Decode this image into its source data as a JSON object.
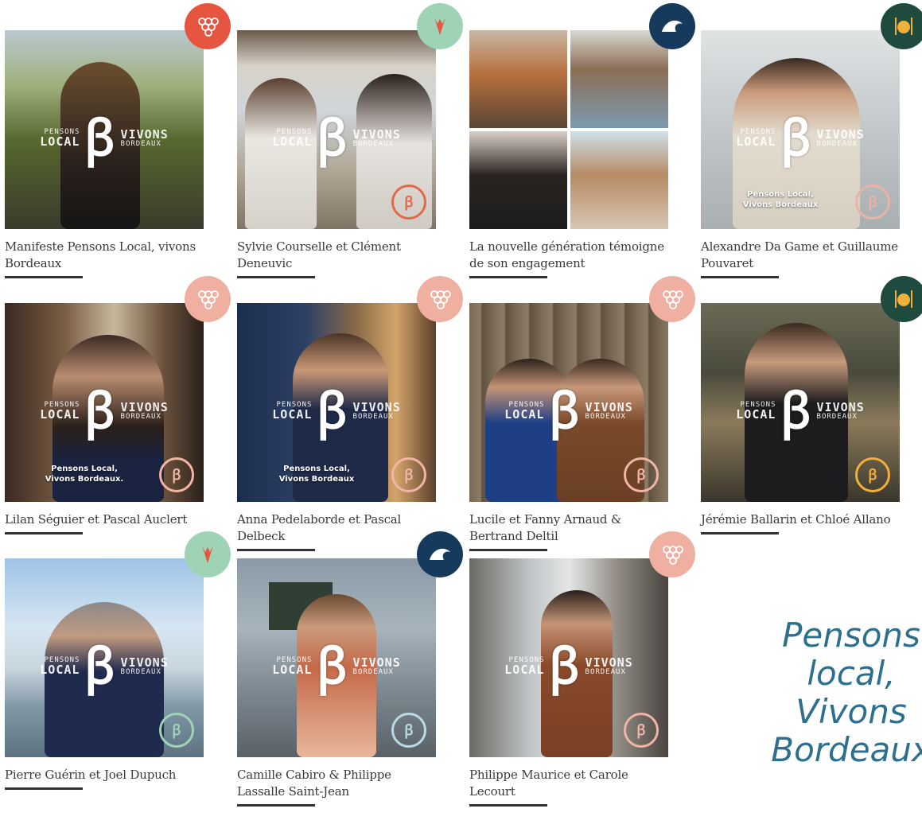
{
  "watermark": {
    "left_top": "PENSONS",
    "left_bottom": "LOCAL",
    "right_top": "VIVONS",
    "right_bottom": "BORDEAUX",
    "glyph": "ꞵ"
  },
  "banner_text_a": "Pensons Local,",
  "banner_text_b": "Vivons Bordeaux.",
  "banner_text_c": "Vivons Bordeaux",
  "slogan": "Pensons local, Vivons Bordeaux",
  "badge_colors": {
    "grape": "#e5553f",
    "grape_light": "#efb0a2",
    "oyster": "#9fd3b6",
    "wave": "#163a5b",
    "food": "#1f4b3e"
  },
  "cards": [
    {
      "title": "Manifeste Pensons Local, vivons Bordeaux",
      "badge": "grape-icon"
    },
    {
      "title": "Sylvie Courselle et Clément Deneuvic",
      "badge": "oyster-icon"
    },
    {
      "title": "La nouvelle génération témoigne de son engagement",
      "badge": "wave-icon"
    },
    {
      "title": "Alexandre Da Game et Guillaume Pouvaret",
      "badge": "plate-icon"
    },
    {
      "title": "Lilan Séguier et Pascal Auclert",
      "badge": "grape-icon"
    },
    {
      "title": "Anna Pedelaborde et Pascal Delbeck",
      "badge": "grape-icon"
    },
    {
      "title": "Lucile et Fanny Arnaud & Bertrand Deltil",
      "badge": "grape-icon"
    },
    {
      "title": "Jérémie Ballarin et Chloé Allano",
      "badge": "plate-icon"
    },
    {
      "title": "Pierre Guérin et Joel Dupuch",
      "badge": "oyster-icon"
    },
    {
      "title": "Camille Cabiro & Philippe Lassalle Saint-Jean",
      "badge": "wave-icon"
    },
    {
      "title": "Philippe Maurice et Carole Lecourt",
      "badge": "grape-icon"
    }
  ]
}
